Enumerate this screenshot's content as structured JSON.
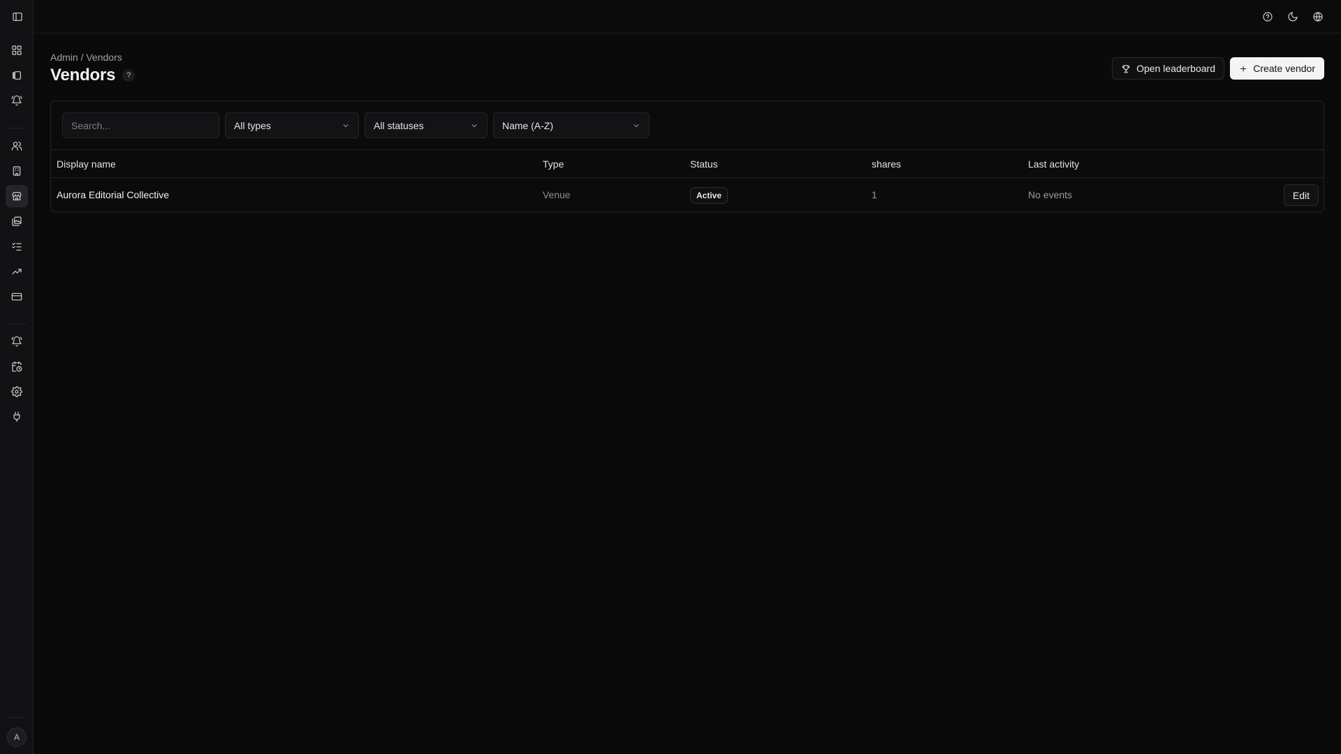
{
  "breadcrumb": {
    "root": "Admin",
    "separator": "/",
    "current": "Vendors"
  },
  "page": {
    "title": "Vendors",
    "help_glyph": "?"
  },
  "actions": {
    "leaderboard_label": "Open leaderboard",
    "create_label": "Create vendor"
  },
  "filters": {
    "search_placeholder": "Search...",
    "type_value": "All types",
    "status_value": "All statuses",
    "sort_value": "Name (A-Z)"
  },
  "table": {
    "columns": [
      "Display name",
      "Type",
      "Status",
      "shares",
      "Last activity"
    ],
    "rows": [
      {
        "name": "Aurora Editorial Collective",
        "type": "Venue",
        "status": "Active",
        "shares": "1",
        "last_activity": "No events",
        "action": "Edit"
      }
    ]
  },
  "sidebar": {
    "toggle_icon": "panel-left-icon",
    "groups": [
      [
        "dashboard-icon",
        "library-icon",
        "bell-ring-icon"
      ],
      [
        "users-icon",
        "building-icon",
        "store-icon",
        "images-icon",
        "list-checks-icon",
        "trending-up-icon",
        "credit-card-icon"
      ],
      [
        "bell-ring-icon",
        "calendar-clock-icon",
        "settings-icon",
        "plug-icon"
      ]
    ],
    "active": "store-icon",
    "avatar_initial": "A"
  },
  "topbar": {
    "icons": [
      "help-circle-icon",
      "moon-icon",
      "globe-icon"
    ]
  },
  "colors": {
    "background": "#0a0a0b",
    "surface": "#121214",
    "border": "#232326",
    "primary_button": "#f4f4f4"
  }
}
